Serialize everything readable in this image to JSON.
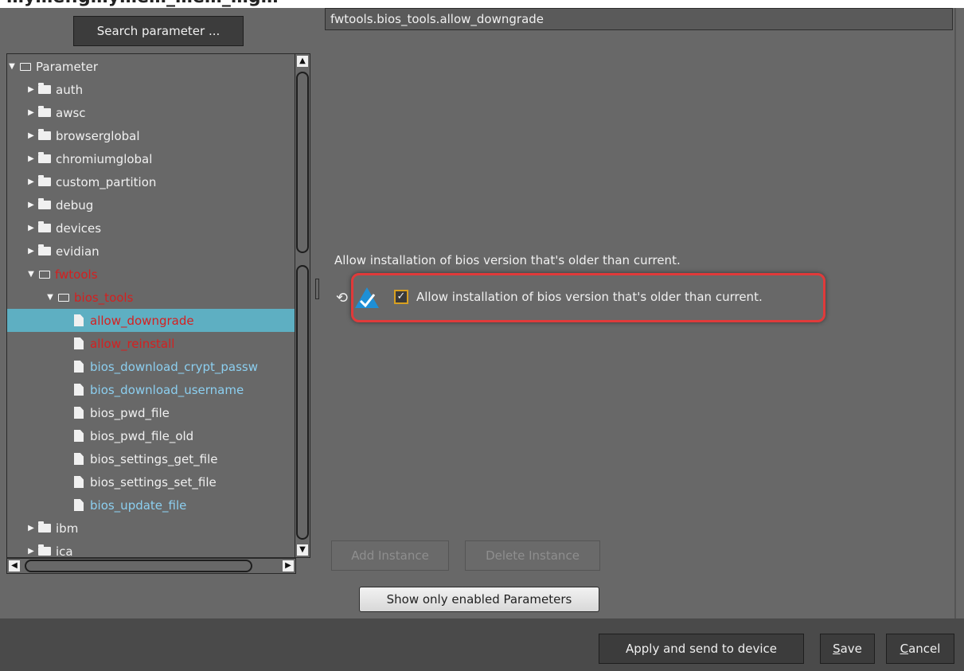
{
  "window_title": "…y…e..g…y…e…_…e…_…g…",
  "left": {
    "search_button": "Search parameter ...",
    "tree": [
      {
        "label": "Parameter",
        "level": 0,
        "expanded": true,
        "type": "folder",
        "color": "white"
      },
      {
        "label": "auth",
        "level": 1,
        "expanded": false,
        "type": "folder",
        "color": "white"
      },
      {
        "label": "awsc",
        "level": 1,
        "expanded": false,
        "type": "folder",
        "color": "white"
      },
      {
        "label": "browserglobal",
        "level": 1,
        "expanded": false,
        "type": "folder",
        "color": "white"
      },
      {
        "label": "chromiumglobal",
        "level": 1,
        "expanded": false,
        "type": "folder",
        "color": "white"
      },
      {
        "label": "custom_partition",
        "level": 1,
        "expanded": false,
        "type": "folder",
        "color": "white"
      },
      {
        "label": "debug",
        "level": 1,
        "expanded": false,
        "type": "folder",
        "color": "white"
      },
      {
        "label": "devices",
        "level": 1,
        "expanded": false,
        "type": "folder",
        "color": "white"
      },
      {
        "label": "evidian",
        "level": 1,
        "expanded": false,
        "type": "folder",
        "color": "white"
      },
      {
        "label": "fwtools",
        "level": 1,
        "expanded": true,
        "type": "folder",
        "color": "red"
      },
      {
        "label": "bios_tools",
        "level": 2,
        "expanded": true,
        "type": "folder",
        "color": "red"
      },
      {
        "label": "allow_downgrade",
        "level": 3,
        "type": "file",
        "color": "red",
        "selected": true
      },
      {
        "label": "allow_reinstall",
        "level": 3,
        "type": "file",
        "color": "red"
      },
      {
        "label": "bios_download_crypt_passw",
        "level": 3,
        "type": "file",
        "color": "blue"
      },
      {
        "label": "bios_download_username",
        "level": 3,
        "type": "file",
        "color": "blue"
      },
      {
        "label": "bios_pwd_file",
        "level": 3,
        "type": "file",
        "color": "white"
      },
      {
        "label": "bios_pwd_file_old",
        "level": 3,
        "type": "file",
        "color": "white"
      },
      {
        "label": "bios_settings_get_file",
        "level": 3,
        "type": "file",
        "color": "white"
      },
      {
        "label": "bios_settings_set_file",
        "level": 3,
        "type": "file",
        "color": "white"
      },
      {
        "label": "bios_update_file",
        "level": 3,
        "type": "file",
        "color": "blue"
      },
      {
        "label": "ibm",
        "level": 1,
        "expanded": false,
        "type": "folder",
        "color": "white"
      },
      {
        "label": "ica",
        "level": 1,
        "expanded": false,
        "type": "folder",
        "color": "white"
      }
    ]
  },
  "right": {
    "path": "fwtools.bios_tools.allow_downgrade",
    "description": "Allow installation of bios version that's older than current.",
    "checkbox_label": "Allow installation of bios version that's older than current.",
    "checkbox_checked": true,
    "icons": {
      "reset": "reset-icon",
      "change": "triangle-check-icon"
    },
    "add_instance": "Add Instance",
    "delete_instance": "Delete Instance",
    "show_enabled": "Show only enabled Parameters"
  },
  "footer": {
    "apply": "Apply and send to device",
    "save_first": "S",
    "save_rest": "ave",
    "cancel_first": "C",
    "cancel_rest": "ancel"
  },
  "colors": {
    "selected_row": "#5eafc2",
    "modified_red": "#d42020",
    "set_blue": "#8ccff0",
    "highlight": "#e03a3a"
  }
}
